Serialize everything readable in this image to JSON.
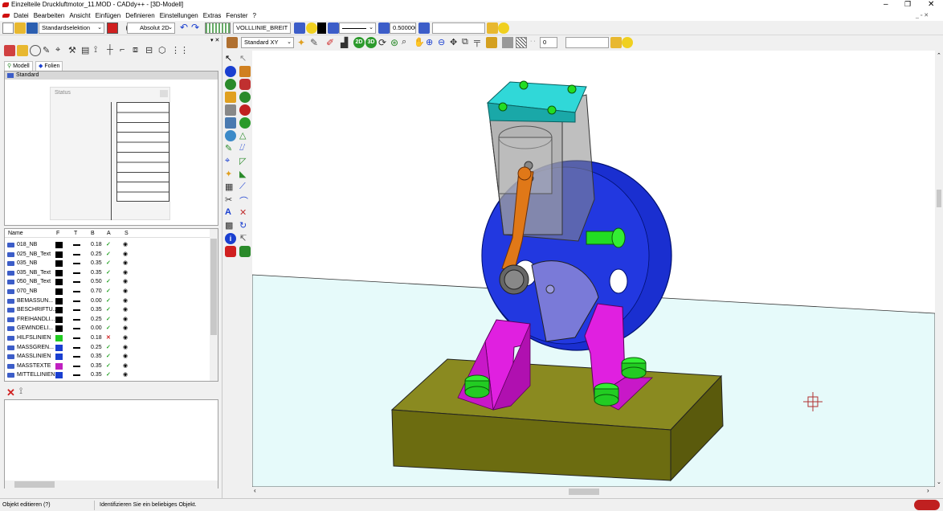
{
  "window": {
    "title": "Einzelteile Druckluftmotor_11.MOD - CADdy++ - [3D-Modell]"
  },
  "menu": [
    "Datei",
    "Bearbeiten",
    "Ansicht",
    "Einfügen",
    "Definieren",
    "Einstellungen",
    "Extras",
    "Fenster",
    "?"
  ],
  "toolbar1": {
    "selection_mode": "Standardselektion",
    "coord_mode": "Absolut 2D",
    "line_type_name": "VOLLLINIE_BREIT",
    "line_width": "0.500000",
    "text_field": ""
  },
  "toolbar2": {
    "view": "Standard XY",
    "btn_2d": "2D",
    "btn_3d": "3D",
    "spin_value": "0",
    "text_field": ""
  },
  "left_panel": {
    "tabs": [
      "Modell",
      "Folien"
    ],
    "active_folie": "Standard",
    "status_title": "Status",
    "columns": [
      "Name",
      "F",
      "T",
      "B",
      "A",
      "S"
    ],
    "layers": [
      {
        "name": "018_NB",
        "color": "#000000",
        "width": "0.18",
        "visible": true
      },
      {
        "name": "025_NB_Text",
        "color": "#000000",
        "width": "0.25",
        "visible": true
      },
      {
        "name": "035_NB",
        "color": "#000000",
        "width": "0.35",
        "visible": true
      },
      {
        "name": "035_NB_Text",
        "color": "#000000",
        "width": "0.35",
        "visible": true
      },
      {
        "name": "050_NB_Text",
        "color": "#000000",
        "width": "0.50",
        "visible": true
      },
      {
        "name": "070_NB",
        "color": "#000000",
        "width": "0.70",
        "visible": true
      },
      {
        "name": "BEMASSUN...",
        "color": "#000000",
        "width": "0.00",
        "visible": true
      },
      {
        "name": "BESCHRIFTU...",
        "color": "#000000",
        "width": "0.35",
        "visible": true
      },
      {
        "name": "FREIHANDLI...",
        "color": "#000000",
        "width": "0.25",
        "visible": true
      },
      {
        "name": "GEWINDELI...",
        "color": "#000000",
        "width": "0.00",
        "visible": true
      },
      {
        "name": "HILFSLINIEN",
        "color": "#22cc22",
        "width": "0.18",
        "visible": false
      },
      {
        "name": "MASSGREN...",
        "color": "#1a3fd0",
        "width": "0.25",
        "visible": true
      },
      {
        "name": "MASSLINIEN",
        "color": "#1a3fd0",
        "width": "0.35",
        "visible": true
      },
      {
        "name": "MASSTEXTE",
        "color": "#c020c0",
        "width": "0.35",
        "visible": true
      },
      {
        "name": "MITTELLINIEN",
        "color": "#1a3fd0",
        "width": "0.35",
        "visible": true
      }
    ]
  },
  "colors": {
    "base_plate": "#7a7a10",
    "flywheel": "#1a2fd0",
    "cylinder_head": "#30d8d8",
    "brackets": "#e020e0",
    "bolts": "#22dd22",
    "conrod": "#e07818",
    "floor": "#e6fafa"
  },
  "status": {
    "left": "Objekt editieren (?)",
    "message": "Identifizieren Sie ein beliebiges Objekt."
  }
}
